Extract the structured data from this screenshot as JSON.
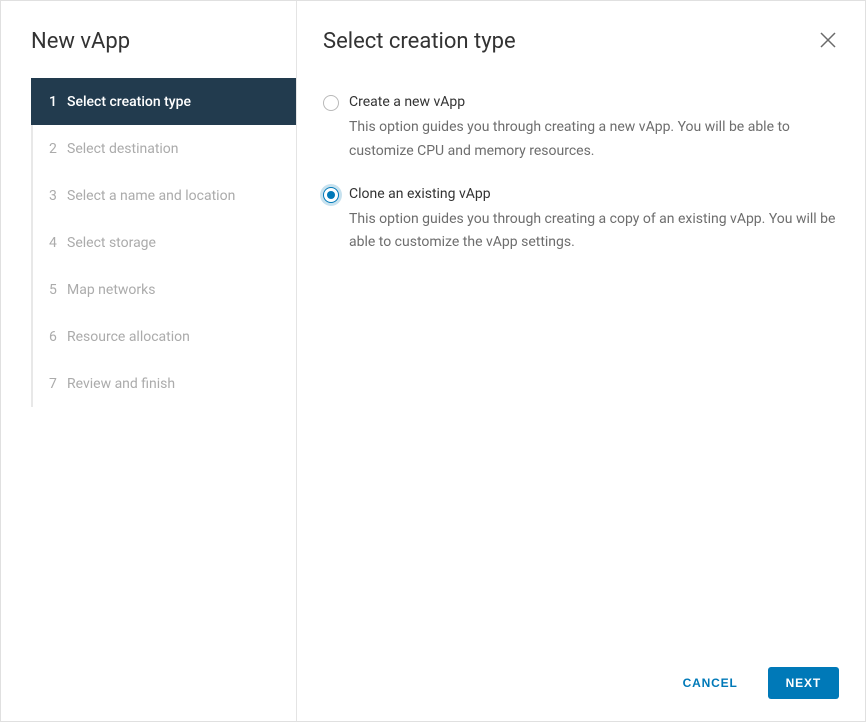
{
  "sidebar": {
    "title": "New vApp",
    "steps": [
      {
        "num": "1",
        "label": "Select creation type",
        "active": true
      },
      {
        "num": "2",
        "label": "Select destination",
        "active": false
      },
      {
        "num": "3",
        "label": "Select a name and location",
        "active": false
      },
      {
        "num": "4",
        "label": "Select storage",
        "active": false
      },
      {
        "num": "5",
        "label": "Map networks",
        "active": false
      },
      {
        "num": "6",
        "label": "Resource allocation",
        "active": false
      },
      {
        "num": "7",
        "label": "Review and finish",
        "active": false
      }
    ]
  },
  "main": {
    "title": "Select creation type",
    "options": [
      {
        "label": "Create a new vApp",
        "description": "This option guides you through creating a new vApp. You will be able to customize CPU and memory resources.",
        "selected": false
      },
      {
        "label": "Clone an existing vApp",
        "description": "This option guides you through creating a copy of an existing vApp. You will be able to customize the vApp settings.",
        "selected": true
      }
    ]
  },
  "footer": {
    "cancel": "CANCEL",
    "next": "NEXT"
  }
}
